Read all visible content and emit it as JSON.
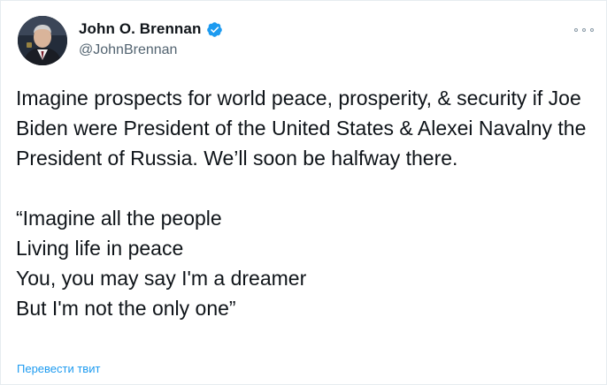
{
  "author": {
    "name": "John O. Brennan",
    "handle": "@JohnBrennan",
    "verified_icon": "verified-badge-icon",
    "badge_color": "#1d9bf0"
  },
  "menu": {
    "icon": "more-options-icon"
  },
  "tweet": {
    "paragraph": "Imagine prospects for world peace, prosperity, & security if Joe Biden were President of the United States & Alexei Navalny the President of Russia. We’ll soon be halfway there.",
    "lyrics": [
      "“Imagine all the people",
      "Living life in peace",
      "You, you may say I'm a dreamer",
      "But I'm not the only one”"
    ]
  },
  "translate_link": "Перевести твит",
  "colors": {
    "text": "#0f1419",
    "secondary": "#536471",
    "link": "#1d9bf0"
  }
}
